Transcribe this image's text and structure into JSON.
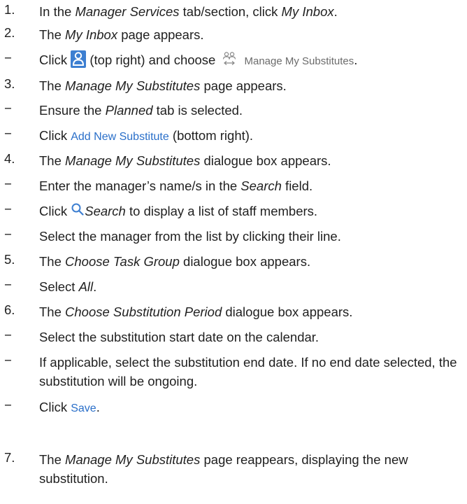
{
  "steps": {
    "s1": {
      "num": "1.",
      "a": "In the ",
      "b": "Manager Services",
      "c": " tab/section, click ",
      "d": "My Inbox",
      "e": "."
    },
    "s2": {
      "num": "2.",
      "a": "The ",
      "b": "My Inbox",
      "c": " page appears."
    },
    "s2a": {
      "dash": "−",
      "a": "Click ",
      "b": " (top right) and choose ",
      "menu": "Manage My Substitutes",
      "e": "."
    },
    "s3": {
      "num": "3.",
      "a": "The ",
      "b": "Manage My Substitutes",
      "c": " page appears."
    },
    "s3a": {
      "dash": "−",
      "a": "Ensure the ",
      "b": "Planned",
      "c": " tab is selected."
    },
    "s3b": {
      "dash": "−",
      "a": "Click ",
      "link": "Add New Substitute",
      "c": " (bottom right)."
    },
    "s4": {
      "num": "4.",
      "a": "The ",
      "b": "Manage My Substitutes",
      "c": " dialogue box appears."
    },
    "s4a": {
      "dash": "−",
      "a": "Enter the manager’s name/s in the ",
      "b": "Search",
      "c": " field."
    },
    "s4b": {
      "dash": "−",
      "a": "Click ",
      "b": "Search",
      "c": " to display a list of staff members."
    },
    "s4c": {
      "dash": "−",
      "a": "Select the manager from the list by clicking their line."
    },
    "s5": {
      "num": "5.",
      "a": "The ",
      "b": "Choose Task Group",
      "c": " dialogue box appears."
    },
    "s5a": {
      "dash": "−",
      "a": "Select ",
      "b": "All",
      "c": "."
    },
    "s6": {
      "num": "6.",
      "a": "The ",
      "b": "Choose Substitution Period",
      "c": " dialogue box appears."
    },
    "s6a": {
      "dash": "−",
      "a": "Select the substitution start date on the calendar."
    },
    "s6b": {
      "dash": "−",
      "a": "If applicable, select the substitution end date. If no end date selected, the substitution will be ongoing."
    },
    "s6c": {
      "dash": "−",
      "a": "Click ",
      "link": "Save",
      "c": "."
    },
    "s7": {
      "num": "7.",
      "a": "The ",
      "b": "Manage My Substitutes",
      "c": " page reappears, displaying the new substitution."
    }
  },
  "icons": {
    "person": "person-icon",
    "substitutes": "substitutes-icon",
    "search": "search-icon",
    "accent": "#3d7fd1",
    "link_color": "#2a6fc9"
  }
}
